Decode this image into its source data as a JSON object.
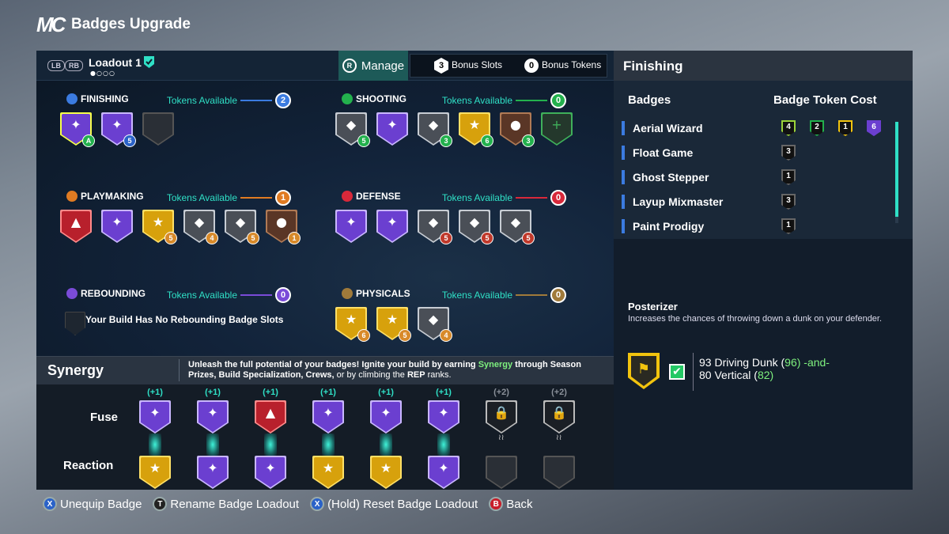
{
  "header": {
    "logo": "MC",
    "title": "Badges Upgrade"
  },
  "loadout": {
    "lb": "LB",
    "rb": "RB",
    "name": "Loadout 1",
    "dots": "●○○○",
    "manage_btn": "R",
    "manage_label": "Manage",
    "bonus_slots_count": "3",
    "bonus_slots_label": "Bonus Slots",
    "bonus_tokens_count": "0",
    "bonus_tokens_label": "Bonus Tokens"
  },
  "categories": [
    {
      "title": "FINISHING",
      "tokens_label": "Tokens Available",
      "tokens": "2",
      "color": "#3b7be0"
    },
    {
      "title": "SHOOTING",
      "tokens_label": "Tokens Available",
      "tokens": "0",
      "color": "#23b14d"
    },
    {
      "title": "PLAYMAKING",
      "tokens_label": "Tokens Available",
      "tokens": "1",
      "color": "#e07b22"
    },
    {
      "title": "DEFENSE",
      "tokens_label": "Tokens Available",
      "tokens": "0",
      "color": "#d8283a"
    },
    {
      "title": "REBOUNDING",
      "tokens_label": "Tokens Available",
      "tokens": "0",
      "color": "#7a4bd8",
      "empty_text": "Your Build Has No Rebounding Badge Slots"
    },
    {
      "title": "PHYSICALS",
      "tokens_label": "Tokens Available",
      "tokens": "0",
      "color": "#a07a3a"
    }
  ],
  "badge_groups": {
    "finishing": [
      {
        "tier": "selected",
        "level": "A"
      },
      {
        "tier": "purple",
        "level": "5"
      },
      {
        "tier": "empty",
        "level": ""
      }
    ],
    "shooting": [
      {
        "tier": "silver",
        "level": "5"
      },
      {
        "tier": "purple",
        "level": ""
      },
      {
        "tier": "silver",
        "level": "3"
      },
      {
        "tier": "gold",
        "level": "6"
      },
      {
        "tier": "bronze",
        "level": "3"
      },
      {
        "tier": "add",
        "level": ""
      }
    ],
    "playmaking": [
      {
        "tier": "red",
        "level": ""
      },
      {
        "tier": "purple",
        "level": ""
      },
      {
        "tier": "gold",
        "level": "5"
      },
      {
        "tier": "silver",
        "level": "4"
      },
      {
        "tier": "silver",
        "level": "5"
      },
      {
        "tier": "bronze",
        "level": "1"
      }
    ],
    "defense": [
      {
        "tier": "purple",
        "level": ""
      },
      {
        "tier": "purple",
        "level": ""
      },
      {
        "tier": "silver",
        "level": "5"
      },
      {
        "tier": "silver",
        "level": "5"
      },
      {
        "tier": "silver",
        "level": "5"
      }
    ],
    "physicals": [
      {
        "tier": "gold",
        "level": "6"
      },
      {
        "tier": "gold",
        "level": "5"
      },
      {
        "tier": "silver",
        "level": "4"
      }
    ]
  },
  "synergy": {
    "title": "Synergy",
    "text_1": "Unleash the full potential of your badges! Ignite your build by earning ",
    "text_highlight": "Synergy",
    "text_2": " through ",
    "text_3": "Season Prizes, Build Specialization, Crews,",
    "text_4": " or by climbing the ",
    "text_5": "REP",
    "text_6": " ranks.",
    "fuse_label": "Fuse",
    "reaction_label": "Reaction",
    "columns": [
      {
        "plus": "(+1)",
        "fuse": "purple",
        "reaction": "gold",
        "locked": false
      },
      {
        "plus": "(+1)",
        "fuse": "purple",
        "reaction": "purple",
        "locked": false
      },
      {
        "plus": "(+1)",
        "fuse": "red",
        "reaction": "purple",
        "locked": false
      },
      {
        "plus": "(+1)",
        "fuse": "purple",
        "reaction": "gold",
        "locked": false
      },
      {
        "plus": "(+1)",
        "fuse": "purple",
        "reaction": "gold",
        "locked": false
      },
      {
        "plus": "(+1)",
        "fuse": "purple",
        "reaction": "purple",
        "locked": false
      },
      {
        "plus": "(+2)",
        "fuse": "locked",
        "reaction": "empty",
        "locked": true
      },
      {
        "plus": "(+2)",
        "fuse": "locked",
        "reaction": "empty",
        "locked": true
      }
    ]
  },
  "right_panel": {
    "title": "Finishing",
    "col_badges": "Badges",
    "col_cost": "Badge Token Cost",
    "rows": [
      {
        "name": "Aerial Wizard",
        "costs": [
          "4",
          "2",
          "1",
          "6"
        ]
      },
      {
        "name": "Float Game",
        "costs": [
          "3"
        ]
      },
      {
        "name": "Ghost Stepper",
        "costs": [
          "1"
        ]
      },
      {
        "name": "Layup Mixmaster",
        "costs": [
          "3"
        ]
      },
      {
        "name": "Paint Prodigy",
        "costs": [
          "1"
        ]
      }
    ],
    "detail_title": "Posterizer",
    "detail_desc": "Increases the chances of throwing down a dunk on your defender.",
    "req_line1_a": "93 Driving Dunk (",
    "req_line1_b": "96",
    "req_line1_c": ") -and-",
    "req_line2_a": "80 Vertical (",
    "req_line2_b": "82",
    "req_line2_c": ")"
  },
  "footer": [
    {
      "btn": "X",
      "label": "Unequip Badge"
    },
    {
      "btn": "T",
      "label": "Rename Badge Loadout"
    },
    {
      "btn": "X",
      "label": "(Hold) Reset Badge Loadout"
    },
    {
      "btn": "B",
      "label": "Back"
    }
  ]
}
